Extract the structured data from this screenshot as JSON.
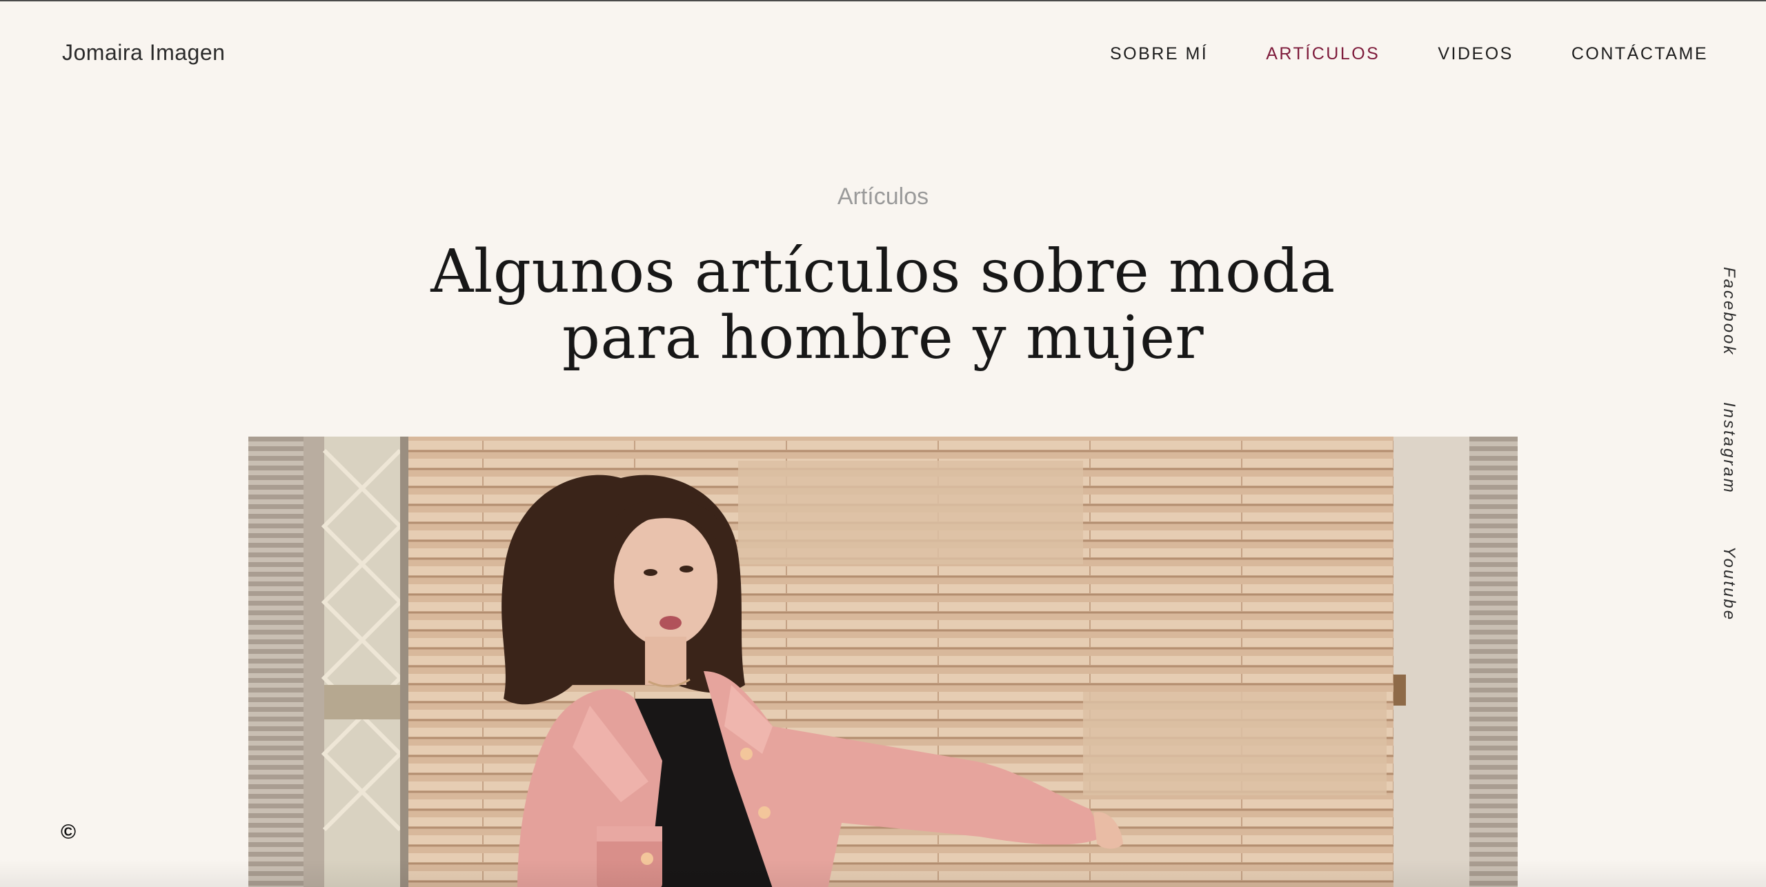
{
  "brand": {
    "name": "Jomaira Imagen"
  },
  "nav": {
    "items": [
      {
        "label": "SOBRE MÍ",
        "active": false
      },
      {
        "label": "ARTÍCULOS",
        "active": true
      },
      {
        "label": "VIDEOS",
        "active": false
      },
      {
        "label": "CONTÁCTAME",
        "active": false
      }
    ]
  },
  "header": {
    "eyebrow": "Artículos",
    "title": "Algunos artículos sobre moda para hombre y mujer"
  },
  "social": {
    "items": [
      {
        "label": "Facebook"
      },
      {
        "label": "Instagram"
      },
      {
        "label": "Youtube"
      }
    ]
  },
  "footer": {
    "copyright_symbol": "©"
  },
  "colors": {
    "background": "#f9f5f0",
    "accent": "#7d1a3a",
    "text": "#1c1c1c",
    "muted": "#9a9a9a"
  }
}
